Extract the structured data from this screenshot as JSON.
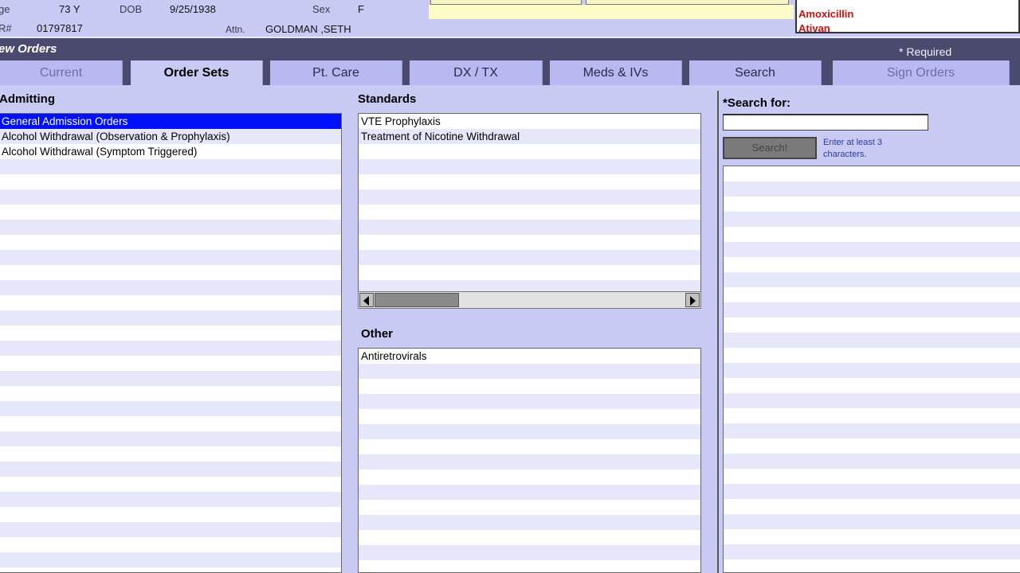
{
  "patient": {
    "age_label": "ge",
    "age_value": "73 Y",
    "dob_label": "DOB",
    "dob_value": "9/25/1938",
    "sex_label": "Sex",
    "sex_value": "F",
    "mrn_label": "R#",
    "mrn_value": "01797817",
    "attn_label": "Attn.",
    "attn_value": "GOLDMAN ,SETH"
  },
  "allergies": [
    "Amoxicillin",
    "Ativan"
  ],
  "titlebar": {
    "title": "ew Orders",
    "required": "* Required"
  },
  "tabs": [
    {
      "label": "Current",
      "active": false
    },
    {
      "label": "Order Sets",
      "active": true
    },
    {
      "label": "Pt. Care",
      "active": false
    },
    {
      "label": "DX / TX",
      "active": false
    },
    {
      "label": "Meds & IVs",
      "active": false
    },
    {
      "label": "Search",
      "active": false
    },
    {
      "label": "Sign Orders",
      "active": false
    }
  ],
  "admitting": {
    "label": "Admitting",
    "items": [
      "General Admission Orders",
      "Alcohol Withdrawal (Observation & Prophylaxis)",
      "Alcohol Withdrawal (Symptom Triggered)"
    ],
    "selected_index": 0
  },
  "standards": {
    "label": "Standards",
    "items": [
      "VTE Prophylaxis",
      "Treatment of Nicotine Withdrawal"
    ]
  },
  "other": {
    "label": "Other",
    "items": [
      "Antiretrovirals"
    ]
  },
  "search": {
    "label": "*Search for:",
    "value": "",
    "button_label": "Search!",
    "hint": "Enter at least 3 characters."
  },
  "colors": {
    "background": "#c8caf4",
    "titlebar": "#4a4a6e",
    "selection": "#0010f8",
    "allergy_text": "#d01010"
  }
}
